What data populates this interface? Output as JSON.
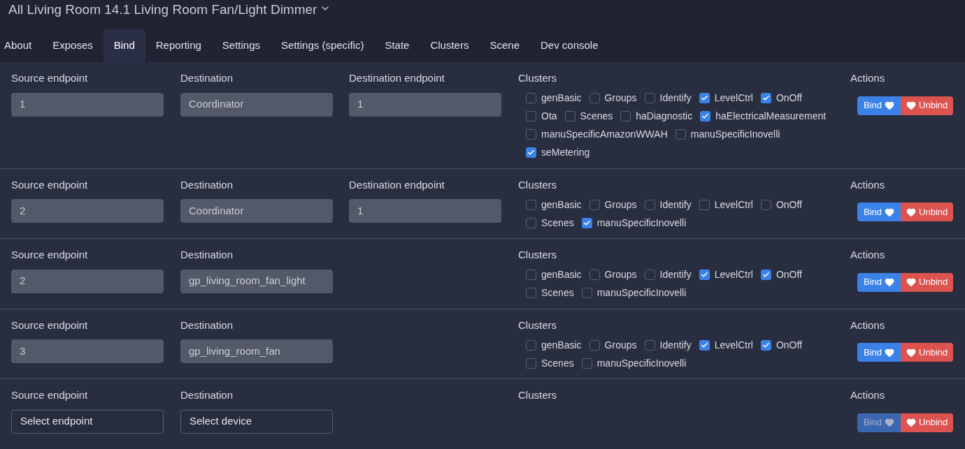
{
  "title": "All Living Room 14.1 Living Room Fan/Light Dimmer",
  "tabs": [
    {
      "label": "About",
      "selected": false
    },
    {
      "label": "Exposes",
      "selected": false
    },
    {
      "label": "Bind",
      "selected": true
    },
    {
      "label": "Reporting",
      "selected": false
    },
    {
      "label": "Settings",
      "selected": false
    },
    {
      "label": "Settings (specific)",
      "selected": false
    },
    {
      "label": "State",
      "selected": false
    },
    {
      "label": "Clusters",
      "selected": false
    },
    {
      "label": "Scene",
      "selected": false
    },
    {
      "label": "Dev console",
      "selected": false
    }
  ],
  "rows": [
    {
      "headers": {
        "source": "Source endpoint",
        "destination": "Destination",
        "destination_endpoint": "Destination endpoint",
        "clusters": "Clusters",
        "actions": "Actions"
      },
      "source": {
        "value": "1",
        "disabled": true
      },
      "destination": {
        "value": "Coordinator",
        "disabled": true
      },
      "destination_endpoint": {
        "value": "1",
        "disabled": true
      },
      "clusters": [
        {
          "label": "genBasic",
          "checked": false
        },
        {
          "label": "Groups",
          "checked": false
        },
        {
          "label": "Identify",
          "checked": false
        },
        {
          "label": "LevelCtrl",
          "checked": true
        },
        {
          "label": "OnOff",
          "checked": true
        },
        {
          "label": "Ota",
          "checked": false
        },
        {
          "label": "Scenes",
          "checked": false
        },
        {
          "label": "haDiagnostic",
          "checked": false
        },
        {
          "label": "haElectricalMeasurement",
          "checked": true
        },
        {
          "label": "manuSpecificAmazonWWAH",
          "checked": false
        },
        {
          "label": "manuSpecificInovelli",
          "checked": false
        },
        {
          "label": "seMetering",
          "checked": true
        }
      ],
      "bind": {
        "label": "Bind",
        "disabled": false
      },
      "unbind": {
        "label": "Unbind",
        "disabled": false
      }
    },
    {
      "headers": {
        "source": "Source endpoint",
        "destination": "Destination",
        "destination_endpoint": "Destination endpoint",
        "clusters": "Clusters",
        "actions": "Actions"
      },
      "source": {
        "value": "2",
        "disabled": true
      },
      "destination": {
        "value": "Coordinator",
        "disabled": true
      },
      "destination_endpoint": {
        "value": "1",
        "disabled": true
      },
      "clusters": [
        {
          "label": "genBasic",
          "checked": false
        },
        {
          "label": "Groups",
          "checked": false
        },
        {
          "label": "Identify",
          "checked": false
        },
        {
          "label": "LevelCtrl",
          "checked": false
        },
        {
          "label": "OnOff",
          "checked": false
        },
        {
          "label": "Scenes",
          "checked": false
        },
        {
          "label": "manuSpecificInovelli",
          "checked": true
        }
      ],
      "bind": {
        "label": "Bind",
        "disabled": false
      },
      "unbind": {
        "label": "Unbind",
        "disabled": false
      }
    },
    {
      "headers": {
        "source": "Source endpoint",
        "destination": "Destination",
        "clusters": "Clusters",
        "actions": "Actions"
      },
      "source": {
        "value": "2",
        "disabled": true
      },
      "destination": {
        "value": "gp_living_room_fan_light",
        "disabled": true
      },
      "clusters": [
        {
          "label": "genBasic",
          "checked": false
        },
        {
          "label": "Groups",
          "checked": false
        },
        {
          "label": "Identify",
          "checked": false
        },
        {
          "label": "LevelCtrl",
          "checked": true
        },
        {
          "label": "OnOff",
          "checked": true
        },
        {
          "label": "Scenes",
          "checked": false
        },
        {
          "label": "manuSpecificInovelli",
          "checked": false
        }
      ],
      "bind": {
        "label": "Bind",
        "disabled": false
      },
      "unbind": {
        "label": "Unbind",
        "disabled": false
      }
    },
    {
      "headers": {
        "source": "Source endpoint",
        "destination": "Destination",
        "clusters": "Clusters",
        "actions": "Actions"
      },
      "source": {
        "value": "3",
        "disabled": true
      },
      "destination": {
        "value": "gp_living_room_fan",
        "disabled": true
      },
      "clusters": [
        {
          "label": "genBasic",
          "checked": false
        },
        {
          "label": "Groups",
          "checked": false
        },
        {
          "label": "Identify",
          "checked": false
        },
        {
          "label": "LevelCtrl",
          "checked": true
        },
        {
          "label": "OnOff",
          "checked": true
        },
        {
          "label": "Scenes",
          "checked": false
        },
        {
          "label": "manuSpecificInovelli",
          "checked": false
        }
      ],
      "bind": {
        "label": "Bind",
        "disabled": false
      },
      "unbind": {
        "label": "Unbind",
        "disabled": false
      }
    },
    {
      "headers": {
        "source": "Source endpoint",
        "destination": "Destination",
        "clusters": "Clusters",
        "actions": "Actions"
      },
      "source": {
        "value": "Select endpoint",
        "disabled": false
      },
      "destination": {
        "value": "Select device",
        "disabled": false
      },
      "clusters": [],
      "bind": {
        "label": "Bind",
        "disabled": true
      },
      "unbind": {
        "label": "Unbind",
        "disabled": false
      }
    }
  ]
}
